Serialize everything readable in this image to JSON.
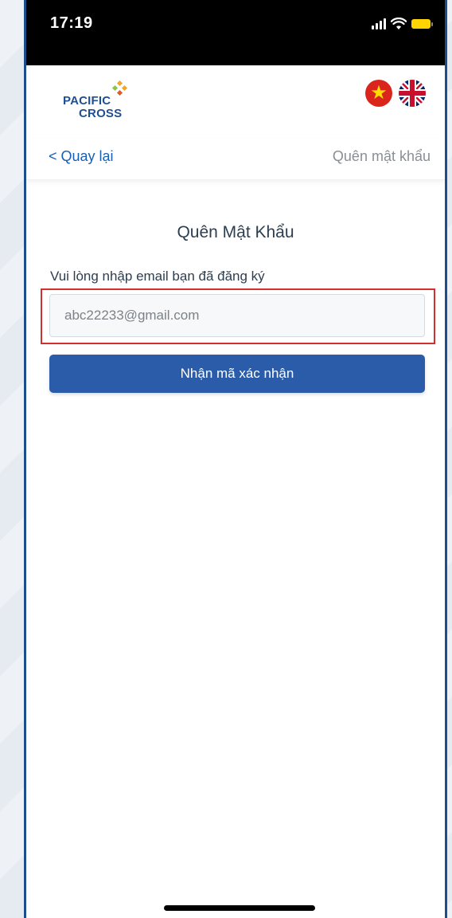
{
  "status_bar": {
    "time": "17:19",
    "battery_color": "#ffd400"
  },
  "header": {
    "logo": {
      "line1": "PACIFIC",
      "line2": "CROSS",
      "brand_color": "#1e4f93"
    },
    "languages": [
      {
        "code": "vi",
        "icon": "vietnam-flag-icon"
      },
      {
        "code": "en",
        "icon": "uk-flag-icon"
      }
    ]
  },
  "nav": {
    "back_label": "< Quay lại",
    "title": "Quên mật khẩu"
  },
  "form": {
    "heading": "Quên Mật Khẩu",
    "email_label": "Vui lòng nhập email bạn đã đăng ký",
    "email_value": "abc22233@gmail.com",
    "submit_label": "Nhận mã xác nhận",
    "button_color": "#2b5caa",
    "highlight_color": "#d32f2f"
  }
}
